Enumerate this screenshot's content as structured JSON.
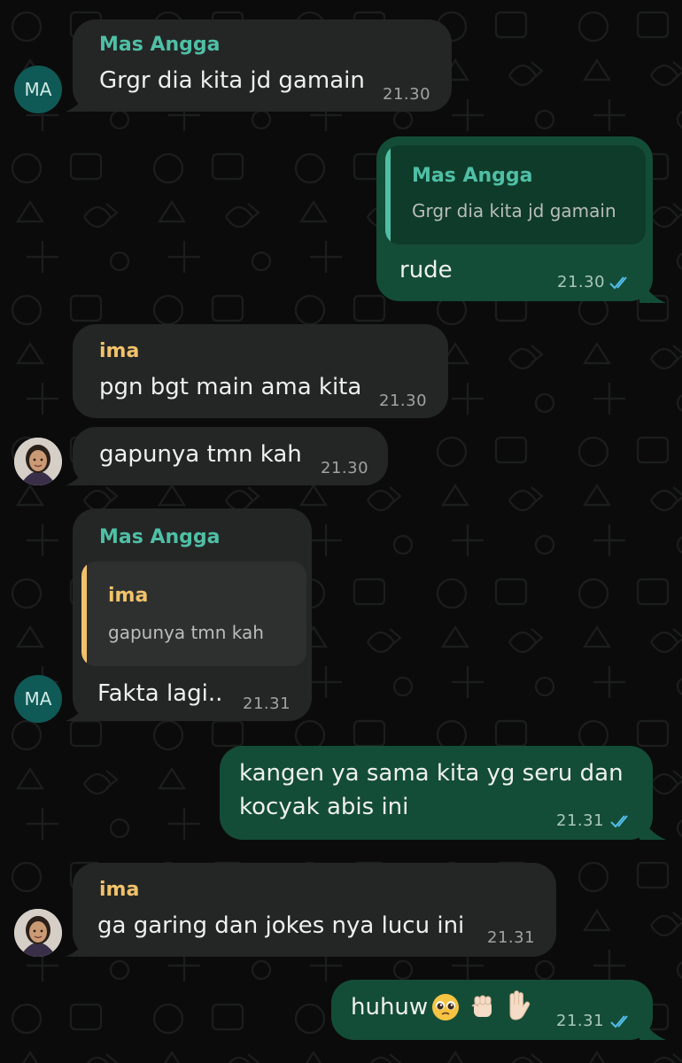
{
  "colors": {
    "incoming_bubble": "#242626",
    "outgoing_bubble": "#144d37",
    "sender_mas_angga": "#4fbfa5",
    "sender_ima": "#f2c26a",
    "read_ticks": "#53bdeb"
  },
  "messages": [
    {
      "sender": "Mas Angga",
      "avatar": "MA",
      "text": "Grgr dia kita jd gamain",
      "time": "21.30"
    },
    {
      "quote_sender": "Mas Angga",
      "quote_text": "Grgr dia kita jd gamain",
      "text": "rude",
      "time": "21.30",
      "status_icon": "double-check-icon"
    },
    {
      "sender": "ima",
      "text": "pgn bgt main ama kita",
      "time": "21.30"
    },
    {
      "text": "gapunya tmn kah",
      "time": "21.30",
      "avatar": "photo-avatar"
    },
    {
      "sender": "Mas Angga",
      "quote_sender": "ima",
      "quote_text": "gapunya tmn kah",
      "text": "Fakta lagi..",
      "time": "21.31",
      "avatar": "MA"
    },
    {
      "text_lines": [
        "kangen ya sama kita yg seru dan",
        "kocyak abis ini"
      ],
      "time": "21.31",
      "status_icon": "double-check-icon"
    },
    {
      "sender": "ima",
      "text": "ga garing dan jokes nya lucu ini",
      "time": "21.31",
      "avatar": "photo-avatar"
    },
    {
      "text": "huhuw",
      "emojis": [
        "pleading-face-emoji",
        "raised-fist-emoji",
        "raised-hand-emoji"
      ],
      "time": "21.31",
      "status_icon": "double-check-icon"
    }
  ]
}
